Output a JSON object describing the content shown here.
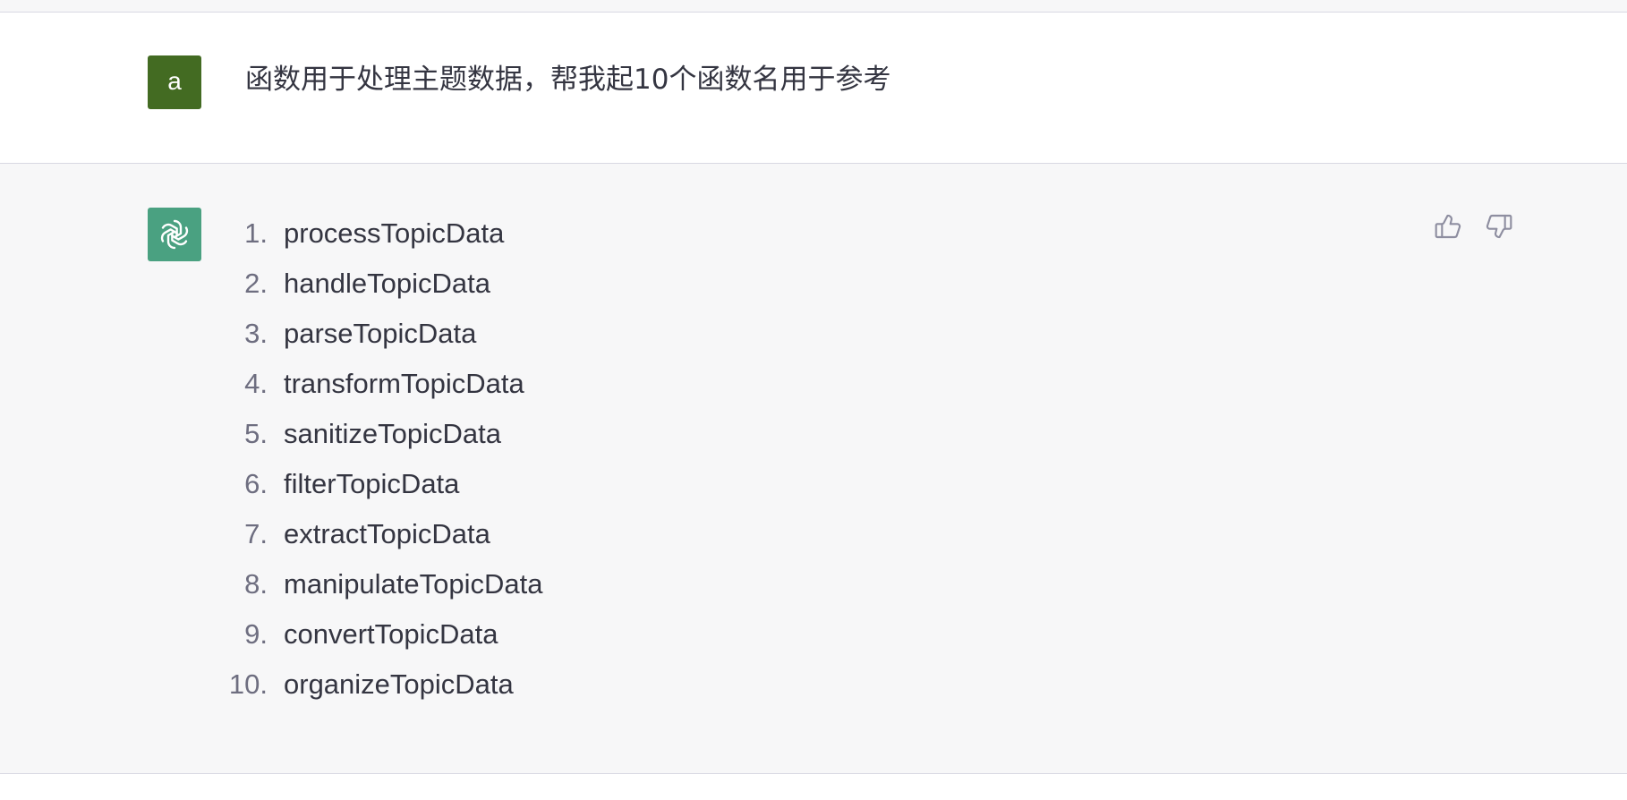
{
  "user_message": {
    "avatar_letter": "a",
    "text": "函数用于处理主题数据，帮我起10个函数名用于参考"
  },
  "assistant_message": {
    "items": [
      {
        "num": "1.",
        "label": "processTopicData"
      },
      {
        "num": "2.",
        "label": "handleTopicData"
      },
      {
        "num": "3.",
        "label": "parseTopicData"
      },
      {
        "num": "4.",
        "label": "transformTopicData"
      },
      {
        "num": "5.",
        "label": "sanitizeTopicData"
      },
      {
        "num": "6.",
        "label": "filterTopicData"
      },
      {
        "num": "7.",
        "label": "extractTopicData"
      },
      {
        "num": "8.",
        "label": "manipulateTopicData"
      },
      {
        "num": "9.",
        "label": "convertTopicData"
      },
      {
        "num": "10.",
        "label": "organizeTopicData"
      }
    ]
  },
  "icons": {
    "bot_avatar": "openai-logo-icon",
    "like": "thumbs-up-icon",
    "dislike": "thumbs-down-icon"
  },
  "colors": {
    "user_avatar_bg": "#436b22",
    "bot_avatar_bg": "#4aa181",
    "assistant_bg": "#f7f7f8"
  }
}
